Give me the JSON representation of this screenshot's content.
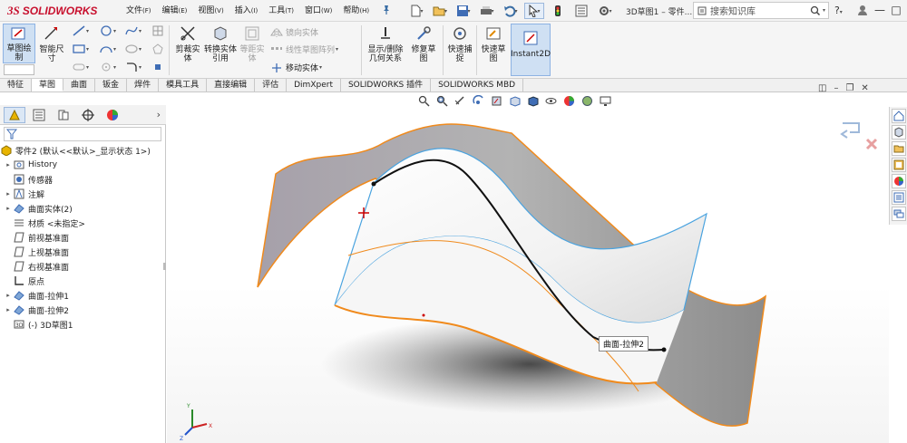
{
  "app": {
    "logo_ds": "3S",
    "logo_name": "SOLIDWORKS",
    "doc_title": "3D草图1 – 零件..."
  },
  "menu": [
    {
      "label": "文件",
      "key": "(F)"
    },
    {
      "label": "编辑",
      "key": "(E)"
    },
    {
      "label": "视图",
      "key": "(V)"
    },
    {
      "label": "插入",
      "key": "(I)"
    },
    {
      "label": "工具",
      "key": "(T)"
    },
    {
      "label": "窗口",
      "key": "(W)"
    },
    {
      "label": "帮助",
      "key": "(H)"
    }
  ],
  "search": {
    "placeholder": "搜索知识库"
  },
  "help": "?",
  "window": {
    "min": "—",
    "max": "□",
    "close": "✕"
  },
  "ribbon": {
    "sketch": "草图绘制",
    "smart_dim": "智能尺寸",
    "trim": "剪裁实体",
    "convert": "转换实体引用",
    "offset": "等距实体",
    "mirror": "镜向实体",
    "linear_pattern": "线性草图阵列",
    "move": "移动实体",
    "relations": "显示/删除几何关系",
    "repair": "修复草图",
    "snap": "快速捕捉",
    "rapid": "快速草图",
    "instant2d": "Instant2D"
  },
  "tabs": [
    {
      "label": "特征",
      "active": false
    },
    {
      "label": "草图",
      "active": true
    },
    {
      "label": "曲面",
      "active": false
    },
    {
      "label": "钣金",
      "active": false
    },
    {
      "label": "焊件",
      "active": false
    },
    {
      "label": "模具工具",
      "active": false
    },
    {
      "label": "直接编辑",
      "active": false
    },
    {
      "label": "评估",
      "active": false
    },
    {
      "label": "DimXpert",
      "active": false
    },
    {
      "label": "SOLIDWORKS 插件",
      "active": false
    },
    {
      "label": "SOLIDWORKS MBD",
      "active": false
    }
  ],
  "tree": {
    "root": "零件2 (默认<<默认>_显示状态 1>)",
    "items": [
      {
        "label": "History",
        "expandable": true,
        "icon": "history-icon"
      },
      {
        "label": "传感器",
        "expandable": false,
        "icon": "sensor-icon"
      },
      {
        "label": "注解",
        "expandable": true,
        "icon": "annotation-icon"
      },
      {
        "label": "曲面实体(2)",
        "expandable": true,
        "icon": "surface-bodies-icon"
      },
      {
        "label": "材质 <未指定>",
        "expandable": false,
        "icon": "material-icon"
      },
      {
        "label": "前视基准面",
        "expandable": false,
        "icon": "plane-icon"
      },
      {
        "label": "上视基准面",
        "expandable": false,
        "icon": "plane-icon"
      },
      {
        "label": "右视基准面",
        "expandable": false,
        "icon": "plane-icon"
      },
      {
        "label": "原点",
        "expandable": false,
        "icon": "origin-icon"
      },
      {
        "label": "曲面-拉伸1",
        "expandable": true,
        "icon": "surface-extrude-icon"
      },
      {
        "label": "曲面-拉伸2",
        "expandable": true,
        "icon": "surface-extrude-icon"
      },
      {
        "label": "(-) 3D草图1",
        "expandable": false,
        "icon": "3d-sketch-icon"
      }
    ]
  },
  "viewport": {
    "tooltip": "曲面-拉伸2"
  },
  "colors": {
    "accent": "#c8102e",
    "edge_orange": "#f08a1c",
    "edge_blue": "#4aa3df",
    "surface_gray": "#8a8a8a"
  }
}
